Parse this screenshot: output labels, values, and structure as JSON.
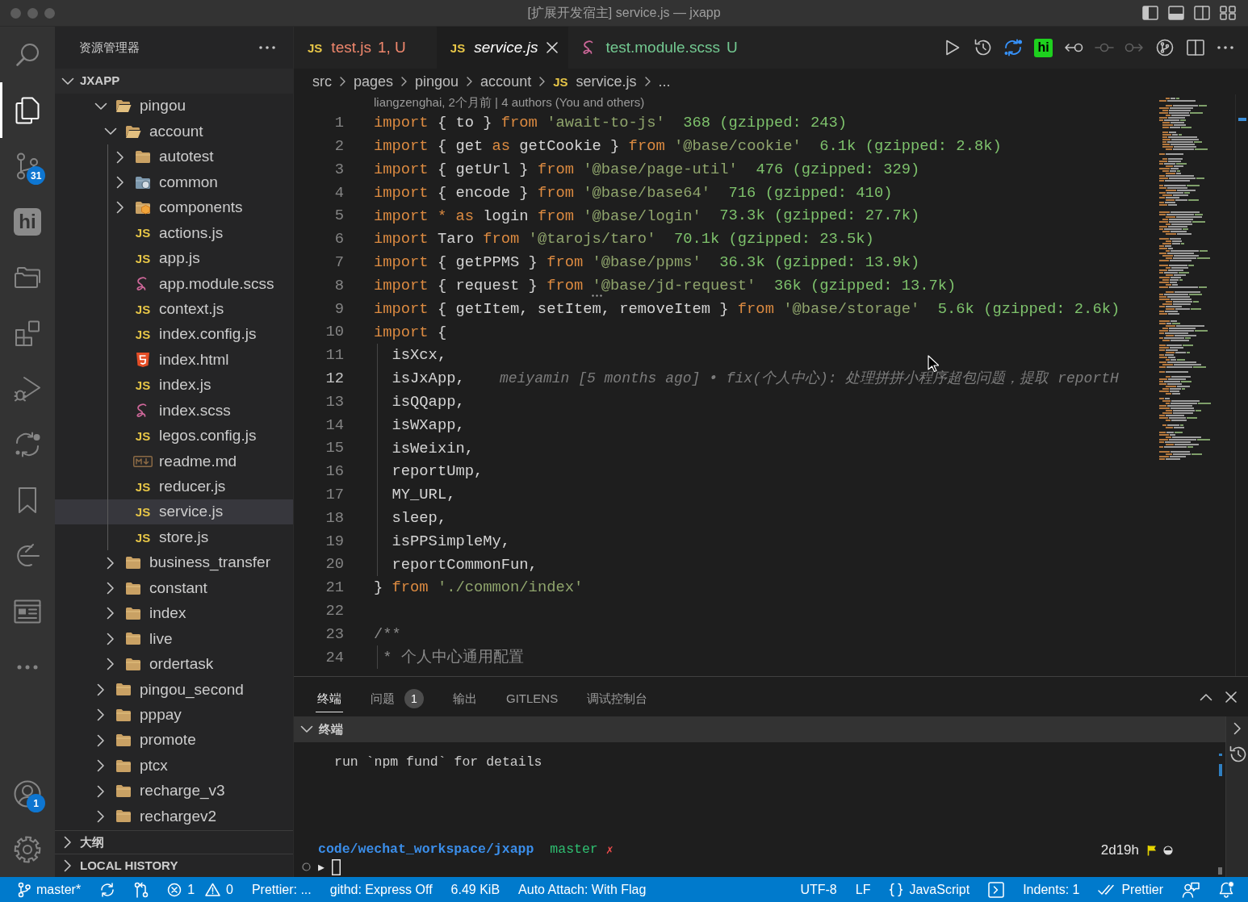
{
  "window": {
    "title": "[扩展开发宿主] service.js — jxapp"
  },
  "activity_bar": {
    "top": [
      {
        "kind": "search",
        "selected": false
      },
      {
        "kind": "explorer",
        "selected": true
      },
      {
        "kind": "source_control",
        "selected": false,
        "badge": "31"
      },
      {
        "kind": "hi",
        "label": "hi",
        "selected": false
      },
      {
        "kind": "folders",
        "selected": false
      },
      {
        "kind": "extensions",
        "selected": false
      },
      {
        "kind": "run_debug",
        "selected": false
      },
      {
        "kind": "diff",
        "selected": false
      },
      {
        "kind": "bookmarks",
        "selected": false
      },
      {
        "kind": "arc",
        "selected": false
      },
      {
        "kind": "window",
        "selected": false
      },
      {
        "kind": "more",
        "selected": false
      }
    ],
    "bottom": [
      {
        "kind": "account",
        "selected": false,
        "badge": "1"
      },
      {
        "kind": "settings",
        "selected": false
      }
    ]
  },
  "sidebar": {
    "title": "资源管理器",
    "root": {
      "label": "JXAPP",
      "expanded": true,
      "children": [
        {
          "label": "pingou",
          "kind": "folder",
          "expanded": true,
          "selected": false,
          "children": [
            {
              "label": "account",
              "kind": "folder",
              "expanded": true,
              "selected": false,
              "children": [
                {
                  "label": "autotest",
                  "kind": "folder",
                  "expanded": false,
                  "selected": false
                },
                {
                  "label": "common",
                  "kind": "folder_common",
                  "expanded": false,
                  "selected": false
                },
                {
                  "label": "components",
                  "kind": "folder_components",
                  "expanded": false,
                  "selected": false
                },
                {
                  "label": "actions.js",
                  "kind": "js",
                  "icon_text": "JS",
                  "selected": false
                },
                {
                  "label": "app.js",
                  "kind": "js",
                  "icon_text": "JS",
                  "selected": false
                },
                {
                  "label": "app.module.scss",
                  "kind": "scss",
                  "selected": false
                },
                {
                  "label": "context.js",
                  "kind": "js",
                  "icon_text": "JS",
                  "selected": false
                },
                {
                  "label": "index.config.js",
                  "kind": "js",
                  "icon_text": "JS",
                  "selected": false
                },
                {
                  "label": "index.html",
                  "kind": "html",
                  "selected": false
                },
                {
                  "label": "index.js",
                  "kind": "js",
                  "icon_text": "JS",
                  "selected": false
                },
                {
                  "label": "index.scss",
                  "kind": "scss",
                  "selected": false
                },
                {
                  "label": "legos.config.js",
                  "kind": "js",
                  "icon_text": "JS",
                  "selected": false
                },
                {
                  "label": "readme.md",
                  "kind": "md",
                  "selected": false
                },
                {
                  "label": "reducer.js",
                  "kind": "js",
                  "icon_text": "JS",
                  "selected": false
                },
                {
                  "label": "service.js",
                  "kind": "js",
                  "icon_text": "JS",
                  "selected": true
                },
                {
                  "label": "store.js",
                  "kind": "js",
                  "icon_text": "JS",
                  "selected": false
                }
              ]
            },
            {
              "label": "business_transfer",
              "kind": "folder",
              "expanded": false,
              "selected": false
            },
            {
              "label": "constant",
              "kind": "folder",
              "expanded": false,
              "selected": false
            },
            {
              "label": "index",
              "kind": "folder",
              "expanded": false,
              "selected": false
            },
            {
              "label": "live",
              "kind": "folder",
              "expanded": false,
              "selected": false
            },
            {
              "label": "ordertask",
              "kind": "folder",
              "expanded": false,
              "selected": false
            }
          ]
        },
        {
          "label": "pingou_second",
          "kind": "folder",
          "expanded": false,
          "selected": false
        },
        {
          "label": "pppay",
          "kind": "folder",
          "expanded": false,
          "selected": false
        },
        {
          "label": "promote",
          "kind": "folder",
          "expanded": false,
          "selected": false
        },
        {
          "label": "ptcx",
          "kind": "folder",
          "expanded": false,
          "selected": false
        },
        {
          "label": "recharge_v3",
          "kind": "folder",
          "expanded": false,
          "selected": false
        },
        {
          "label": "rechargev2",
          "kind": "folder",
          "expanded": false,
          "selected": false
        }
      ]
    },
    "sections": [
      {
        "label": "大纲",
        "expanded": false
      },
      {
        "label": "LOCAL HISTORY",
        "expanded": false
      }
    ]
  },
  "editor": {
    "tabs": [
      {
        "label": "test.js",
        "kind": "js",
        "icon_text": "JS",
        "status": "1, U",
        "color": "#f0876d",
        "preview": false,
        "selected": false
      },
      {
        "label": "service.js",
        "kind": "js",
        "icon_text": "JS",
        "preview": true,
        "selected": true
      },
      {
        "label": "test.module.scss",
        "kind": "scss",
        "status": "U",
        "color": "#73c991",
        "preview": false,
        "selected": false
      }
    ],
    "actions": [
      {
        "kind": "run",
        "disabled": false
      },
      {
        "kind": "history",
        "disabled": false
      },
      {
        "kind": "sync_diff",
        "disabled": false
      },
      {
        "kind": "hi",
        "label": "hi",
        "disabled": false
      },
      {
        "kind": "back",
        "disabled": false
      },
      {
        "kind": "commit",
        "disabled": true
      },
      {
        "kind": "forward",
        "disabled": true
      },
      {
        "kind": "graph",
        "disabled": false
      },
      {
        "kind": "split",
        "disabled": false
      },
      {
        "kind": "more",
        "disabled": false
      }
    ],
    "breadcrumbs": [
      {
        "label": "src",
        "kind": "path"
      },
      {
        "label": "pages",
        "kind": "path"
      },
      {
        "label": "pingou",
        "kind": "path"
      },
      {
        "label": "account",
        "kind": "path"
      },
      {
        "label": "service.js",
        "kind": "js",
        "icon_text": "JS"
      },
      {
        "label": "...",
        "kind": "path"
      }
    ],
    "blame_header": "liangzenghai, 2个月前 | 4 authors (You and others)",
    "lines": [
      {
        "number": "1",
        "current": false,
        "guide": false,
        "tokens": [
          {
            "kind": "keyword",
            "text": "import"
          },
          {
            "kind": "text",
            "text": " { to } "
          },
          {
            "kind": "keyword",
            "text": "from "
          },
          {
            "kind": "string",
            "text": "'await-to-js'"
          }
        ],
        "import_cost": "368 (gzipped: 243)"
      },
      {
        "number": "2",
        "current": false,
        "guide": false,
        "tokens": [
          {
            "kind": "keyword",
            "text": "import"
          },
          {
            "kind": "text",
            "text": " { get "
          },
          {
            "kind": "keyword",
            "text": "as"
          },
          {
            "kind": "text",
            "text": " getCookie } "
          },
          {
            "kind": "keyword",
            "text": "from "
          },
          {
            "kind": "string",
            "text": "'@base/cookie'"
          }
        ],
        "import_cost": "6.1k (gzipped: 2.8k)"
      },
      {
        "number": "3",
        "current": false,
        "guide": false,
        "tokens": [
          {
            "kind": "keyword",
            "text": "import"
          },
          {
            "kind": "text",
            "text": " { getUrl } "
          },
          {
            "kind": "keyword",
            "text": "from "
          },
          {
            "kind": "string",
            "text": "'@base/page-util'"
          }
        ],
        "import_cost": "476 (gzipped: 329)"
      },
      {
        "number": "4",
        "current": false,
        "guide": false,
        "tokens": [
          {
            "kind": "keyword",
            "text": "import"
          },
          {
            "kind": "text",
            "text": " { encode } "
          },
          {
            "kind": "keyword",
            "text": "from "
          },
          {
            "kind": "string",
            "text": "'@base/base64'"
          }
        ],
        "import_cost": "716 (gzipped: 410)"
      },
      {
        "number": "5",
        "current": false,
        "guide": false,
        "tokens": [
          {
            "kind": "keyword",
            "text": "import * as"
          },
          {
            "kind": "text",
            "text": " login "
          },
          {
            "kind": "keyword",
            "text": "from "
          },
          {
            "kind": "string",
            "text": "'@base/login'"
          }
        ],
        "import_cost": "73.3k (gzipped: 27.7k)"
      },
      {
        "number": "6",
        "current": false,
        "guide": false,
        "tokens": [
          {
            "kind": "keyword",
            "text": "import"
          },
          {
            "kind": "text",
            "text": " Taro "
          },
          {
            "kind": "keyword",
            "text": "from "
          },
          {
            "kind": "string",
            "text": "'@tarojs/taro'"
          }
        ],
        "import_cost": "70.1k (gzipped: 23.5k)"
      },
      {
        "number": "7",
        "current": false,
        "guide": false,
        "tokens": [
          {
            "kind": "keyword",
            "text": "import"
          },
          {
            "kind": "text",
            "text": " { getPPMS } "
          },
          {
            "kind": "keyword",
            "text": "from "
          },
          {
            "kind": "string",
            "text": "'@base/ppms'"
          }
        ],
        "import_cost": "36.3k (gzipped: 13.9k)"
      },
      {
        "number": "8",
        "current": false,
        "guide": false,
        "tokens": [
          {
            "kind": "keyword",
            "text": "import"
          },
          {
            "kind": "text",
            "text": " { request } "
          },
          {
            "kind": "keyword",
            "text": "from "
          },
          {
            "kind": "string",
            "text": "'@base/jd-request'",
            "hint": true
          }
        ],
        "import_cost": "36k (gzipped: 13.7k)"
      },
      {
        "number": "9",
        "current": false,
        "guide": false,
        "tokens": [
          {
            "kind": "keyword",
            "text": "import"
          },
          {
            "kind": "text",
            "text": " { getItem, setItem, removeItem } "
          },
          {
            "kind": "keyword",
            "text": "from "
          },
          {
            "kind": "string",
            "text": "'@base/storage'"
          }
        ],
        "import_cost": "5.6k (gzipped: 2.6k)"
      },
      {
        "number": "10",
        "current": false,
        "guide": false,
        "tokens": [
          {
            "kind": "keyword",
            "text": "import"
          },
          {
            "kind": "text",
            "text": " {"
          }
        ]
      },
      {
        "number": "11",
        "current": false,
        "guide": true,
        "tokens": [
          {
            "kind": "text",
            "text": "  isXcx,"
          }
        ]
      },
      {
        "number": "12",
        "current": true,
        "guide": true,
        "tokens": [
          {
            "kind": "text",
            "text": "  isJxApp,"
          }
        ],
        "blame": "meiyamin [5 months ago] • fix(个人中心): 处理拼拼小程序超包问题，提取 reportH"
      },
      {
        "number": "13",
        "current": false,
        "guide": true,
        "tokens": [
          {
            "kind": "text",
            "text": "  isQQapp,"
          }
        ]
      },
      {
        "number": "14",
        "current": false,
        "guide": true,
        "tokens": [
          {
            "kind": "text",
            "text": "  isWXapp,"
          }
        ]
      },
      {
        "number": "15",
        "current": false,
        "guide": true,
        "tokens": [
          {
            "kind": "text",
            "text": "  isWeixin,"
          }
        ]
      },
      {
        "number": "16",
        "current": false,
        "guide": true,
        "tokens": [
          {
            "kind": "text",
            "text": "  reportUmp,"
          }
        ]
      },
      {
        "number": "17",
        "current": false,
        "guide": true,
        "tokens": [
          {
            "kind": "text",
            "text": "  MY_URL,"
          }
        ]
      },
      {
        "number": "18",
        "current": false,
        "guide": true,
        "tokens": [
          {
            "kind": "text",
            "text": "  sleep,"
          }
        ]
      },
      {
        "number": "19",
        "current": false,
        "guide": true,
        "tokens": [
          {
            "kind": "text",
            "text": "  isPPSimpleMy,"
          }
        ]
      },
      {
        "number": "20",
        "current": false,
        "guide": true,
        "tokens": [
          {
            "kind": "text",
            "text": "  reportCommonFun,"
          }
        ]
      },
      {
        "number": "21",
        "current": false,
        "guide": false,
        "tokens": [
          {
            "kind": "text",
            "text": "} "
          },
          {
            "kind": "keyword",
            "text": "from "
          },
          {
            "kind": "string",
            "text": "'./common/index'"
          }
        ]
      },
      {
        "number": "22",
        "current": false,
        "guide": false
      },
      {
        "number": "23",
        "current": false,
        "guide": false,
        "tokens": [
          {
            "kind": "comment",
            "text": "/**"
          }
        ]
      },
      {
        "number": "24",
        "current": false,
        "guide": true,
        "tokens": [
          {
            "kind": "comment",
            "text": " * 个人中心通用配置"
          }
        ]
      }
    ]
  },
  "panel": {
    "tabs": [
      {
        "label": "终端",
        "selected": true
      },
      {
        "label": "问题",
        "selected": false,
        "badge": "1"
      },
      {
        "label": "输出",
        "selected": false
      },
      {
        "label": "GITLENS",
        "selected": false
      },
      {
        "label": "调试控制台",
        "selected": false
      }
    ],
    "section": {
      "label": "终端",
      "expanded": true
    },
    "terminal": {
      "output": [
        "run `npm fund` for details"
      ],
      "prompt": {
        "path": "code/wechat_workspace/jxapp",
        "branch": "master",
        "dirty": "✗",
        "elapsed": "2d19h"
      },
      "input_symbol": "▶"
    }
  },
  "status_bar": {
    "left": [
      {
        "kind": "branch",
        "label": "master*"
      },
      {
        "kind": "sync"
      },
      {
        "kind": "pull_request"
      },
      {
        "kind": "problems",
        "errors": "1",
        "warnings": "0"
      },
      {
        "kind": "text",
        "label": "Prettier: ..."
      },
      {
        "kind": "text",
        "label": "githd: Express Off"
      },
      {
        "kind": "text",
        "label": "6.49 KiB"
      },
      {
        "kind": "text",
        "label": "Auto Attach: With Flag"
      }
    ],
    "right": [
      {
        "kind": "text",
        "label": "UTF-8"
      },
      {
        "kind": "text",
        "label": "LF"
      },
      {
        "kind": "language",
        "label": "JavaScript"
      },
      {
        "kind": "terminal"
      },
      {
        "kind": "text",
        "label": "Indents: 1"
      },
      {
        "kind": "prettier",
        "label": "Prettier"
      },
      {
        "kind": "feedback"
      },
      {
        "kind": "notifications",
        "unread": true
      }
    ]
  }
}
